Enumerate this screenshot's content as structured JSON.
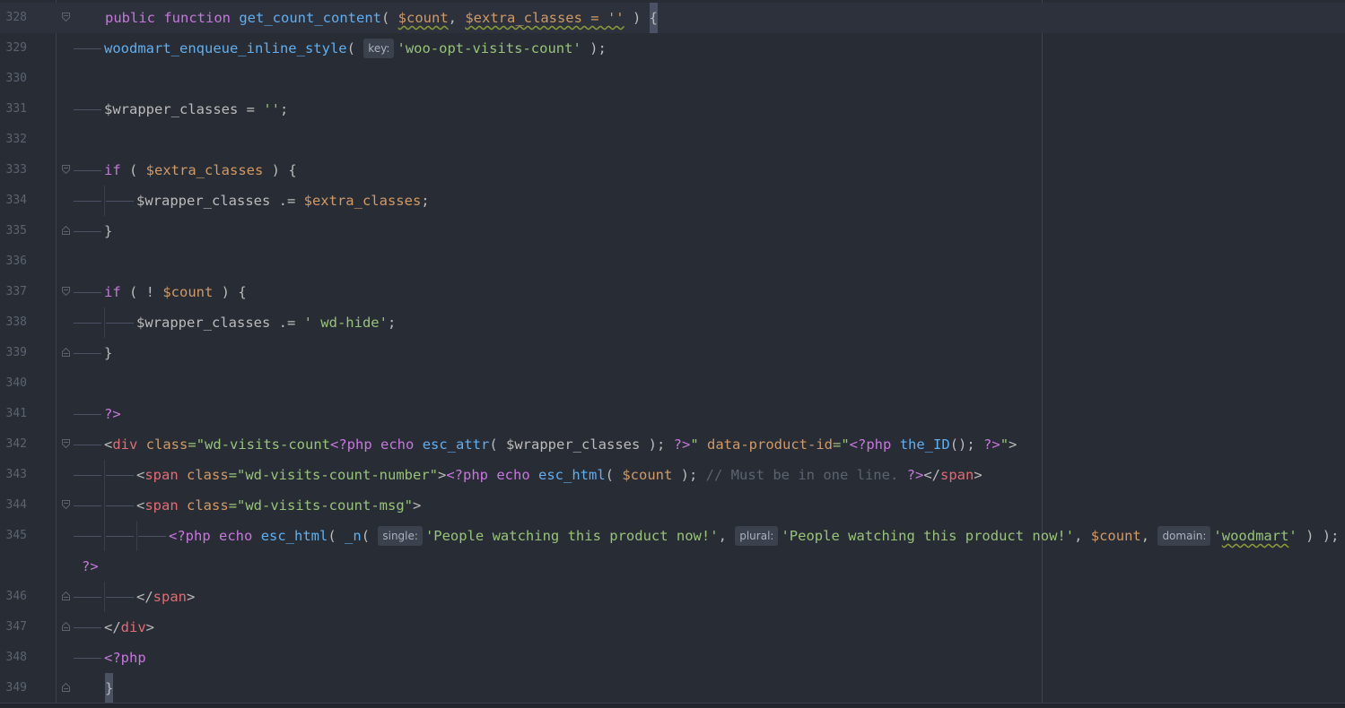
{
  "editor": {
    "lines": [
      {
        "num": "328",
        "indent": 0,
        "current": true,
        "fold": "open",
        "tokens": [
          {
            "t": "public",
            "c": "kw"
          },
          {
            "t": " ",
            "c": "pl"
          },
          {
            "t": "function",
            "c": "kw"
          },
          {
            "t": " ",
            "c": "pl"
          },
          {
            "t": "get_count_content",
            "c": "fn"
          },
          {
            "t": "( ",
            "c": "pl"
          },
          {
            "t": "$count",
            "c": "var",
            "w": true
          },
          {
            "t": ", ",
            "c": "pl"
          },
          {
            "t": "$extra_classes = ''",
            "c": "var",
            "w": true
          },
          {
            "t": " ) ",
            "c": "pl"
          },
          {
            "t": "{",
            "c": "pl",
            "caret": true
          }
        ]
      },
      {
        "num": "329",
        "indent": 1,
        "tokens": [
          {
            "t": "woodmart_enqueue_inline_style",
            "c": "fn"
          },
          {
            "t": "( ",
            "c": "pl"
          },
          {
            "hint": "key:"
          },
          {
            "t": "'woo-opt-visits-count'",
            "c": "str"
          },
          {
            "t": " );",
            "c": "pl"
          }
        ]
      },
      {
        "num": "330",
        "indent": 0,
        "tokens": []
      },
      {
        "num": "331",
        "indent": 1,
        "tokens": [
          {
            "t": "$wrapper_classes = ",
            "c": "pl"
          },
          {
            "t": "''",
            "c": "str"
          },
          {
            "t": ";",
            "c": "pl"
          }
        ]
      },
      {
        "num": "332",
        "indent": 0,
        "tokens": []
      },
      {
        "num": "333",
        "indent": 1,
        "fold": "open",
        "tokens": [
          {
            "t": "if",
            "c": "kw"
          },
          {
            "t": " ( ",
            "c": "pl"
          },
          {
            "t": "$extra_classes",
            "c": "var"
          },
          {
            "t": " ) {",
            "c": "pl"
          }
        ]
      },
      {
        "num": "334",
        "indent": 2,
        "tokens": [
          {
            "t": "$wrapper_classes .= ",
            "c": "pl"
          },
          {
            "t": "$extra_classes",
            "c": "var"
          },
          {
            "t": ";",
            "c": "pl"
          }
        ]
      },
      {
        "num": "335",
        "indent": 1,
        "fold": "close",
        "tokens": [
          {
            "t": "}",
            "c": "pl"
          }
        ]
      },
      {
        "num": "336",
        "indent": 0,
        "tokens": []
      },
      {
        "num": "337",
        "indent": 1,
        "fold": "open",
        "tokens": [
          {
            "t": "if",
            "c": "kw"
          },
          {
            "t": " ( ! ",
            "c": "pl"
          },
          {
            "t": "$count",
            "c": "var"
          },
          {
            "t": " ) {",
            "c": "pl"
          }
        ]
      },
      {
        "num": "338",
        "indent": 2,
        "tokens": [
          {
            "t": "$wrapper_classes .= ",
            "c": "pl"
          },
          {
            "t": "' wd-hide'",
            "c": "str"
          },
          {
            "t": ";",
            "c": "pl"
          }
        ]
      },
      {
        "num": "339",
        "indent": 1,
        "fold": "close",
        "tokens": [
          {
            "t": "}",
            "c": "pl"
          }
        ]
      },
      {
        "num": "340",
        "indent": 0,
        "tokens": []
      },
      {
        "num": "341",
        "indent": 1,
        "tokens": [
          {
            "t": "?>",
            "c": "php"
          }
        ]
      },
      {
        "num": "342",
        "indent": 1,
        "fold": "open",
        "tokens": [
          {
            "t": "<",
            "c": "pl"
          },
          {
            "t": "div",
            "c": "tag"
          },
          {
            "t": " ",
            "c": "pl"
          },
          {
            "t": "class",
            "c": "attr"
          },
          {
            "t": "=\"wd-visits-count",
            "c": "str"
          },
          {
            "t": "<?php",
            "c": "php"
          },
          {
            "t": " ",
            "c": "pl"
          },
          {
            "t": "echo",
            "c": "kw"
          },
          {
            "t": " ",
            "c": "pl"
          },
          {
            "t": "esc_attr",
            "c": "fn"
          },
          {
            "t": "( $wrapper_classes ); ",
            "c": "pl"
          },
          {
            "t": "?>",
            "c": "php"
          },
          {
            "t": "\"",
            "c": "str"
          },
          {
            "t": " ",
            "c": "pl"
          },
          {
            "t": "data-product-id",
            "c": "attr"
          },
          {
            "t": "=\"",
            "c": "str"
          },
          {
            "t": "<?php",
            "c": "php"
          },
          {
            "t": " ",
            "c": "pl"
          },
          {
            "t": "the_ID",
            "c": "fn"
          },
          {
            "t": "(); ",
            "c": "pl"
          },
          {
            "t": "?>",
            "c": "php"
          },
          {
            "t": "\"",
            "c": "str"
          },
          {
            "t": ">",
            "c": "pl"
          }
        ]
      },
      {
        "num": "343",
        "indent": 2,
        "tokens": [
          {
            "t": "<",
            "c": "pl"
          },
          {
            "t": "span",
            "c": "tag"
          },
          {
            "t": " ",
            "c": "pl"
          },
          {
            "t": "class",
            "c": "attr"
          },
          {
            "t": "=\"wd-visits-count-number\"",
            "c": "str"
          },
          {
            "t": ">",
            "c": "pl"
          },
          {
            "t": "<?php",
            "c": "php"
          },
          {
            "t": " ",
            "c": "pl"
          },
          {
            "t": "echo",
            "c": "kw"
          },
          {
            "t": " ",
            "c": "pl"
          },
          {
            "t": "esc_html",
            "c": "fn"
          },
          {
            "t": "( ",
            "c": "pl"
          },
          {
            "t": "$count",
            "c": "var"
          },
          {
            "t": " ); ",
            "c": "pl"
          },
          {
            "t": "// Must be in one line. ",
            "c": "cm"
          },
          {
            "t": "?>",
            "c": "php"
          },
          {
            "t": "</",
            "c": "pl"
          },
          {
            "t": "span",
            "c": "tag"
          },
          {
            "t": ">",
            "c": "pl"
          }
        ]
      },
      {
        "num": "344",
        "indent": 2,
        "fold": "open",
        "tokens": [
          {
            "t": "<",
            "c": "pl"
          },
          {
            "t": "span",
            "c": "tag"
          },
          {
            "t": " ",
            "c": "pl"
          },
          {
            "t": "class",
            "c": "attr"
          },
          {
            "t": "=\"wd-visits-count-msg\"",
            "c": "str"
          },
          {
            "t": ">",
            "c": "pl"
          }
        ]
      },
      {
        "num": "345",
        "indent": 3,
        "tokens": [
          {
            "t": "<?php",
            "c": "php"
          },
          {
            "t": " ",
            "c": "pl"
          },
          {
            "t": "echo",
            "c": "kw"
          },
          {
            "t": " ",
            "c": "pl"
          },
          {
            "t": "esc_html",
            "c": "fn"
          },
          {
            "t": "( ",
            "c": "pl"
          },
          {
            "t": "_n",
            "c": "fn"
          },
          {
            "t": "( ",
            "c": "pl"
          },
          {
            "hint": "single:"
          },
          {
            "t": "'People watching this product now!'",
            "c": "str"
          },
          {
            "t": ", ",
            "c": "pl"
          },
          {
            "hint": "plural:"
          },
          {
            "t": "'People watching this product now!'",
            "c": "str"
          },
          {
            "t": ", ",
            "c": "pl"
          },
          {
            "t": "$count",
            "c": "var"
          },
          {
            "t": ", ",
            "c": "pl"
          },
          {
            "hint": "domain:"
          },
          {
            "t": "'",
            "c": "str"
          },
          {
            "t": "woodmart",
            "c": "str",
            "w": true
          },
          {
            "t": "'",
            "c": "str"
          },
          {
            "t": " ) );",
            "c": "pl"
          }
        ]
      },
      {
        "num": "",
        "indent": 0,
        "wrap": true,
        "tokens": [
          {
            "t": "?>",
            "c": "php"
          }
        ]
      },
      {
        "num": "346",
        "indent": 2,
        "fold": "close",
        "tokens": [
          {
            "t": "</",
            "c": "pl"
          },
          {
            "t": "span",
            "c": "tag"
          },
          {
            "t": ">",
            "c": "pl"
          }
        ]
      },
      {
        "num": "347",
        "indent": 1,
        "fold": "close",
        "tokens": [
          {
            "t": "</",
            "c": "pl"
          },
          {
            "t": "div",
            "c": "tag"
          },
          {
            "t": ">",
            "c": "pl"
          }
        ]
      },
      {
        "num": "348",
        "indent": 1,
        "tokens": [
          {
            "t": "<?php",
            "c": "php"
          }
        ]
      },
      {
        "num": "349",
        "indent": 0,
        "fold": "close",
        "tokens": [
          {
            "t": "}",
            "c": "pl",
            "caret": true
          }
        ]
      }
    ]
  }
}
